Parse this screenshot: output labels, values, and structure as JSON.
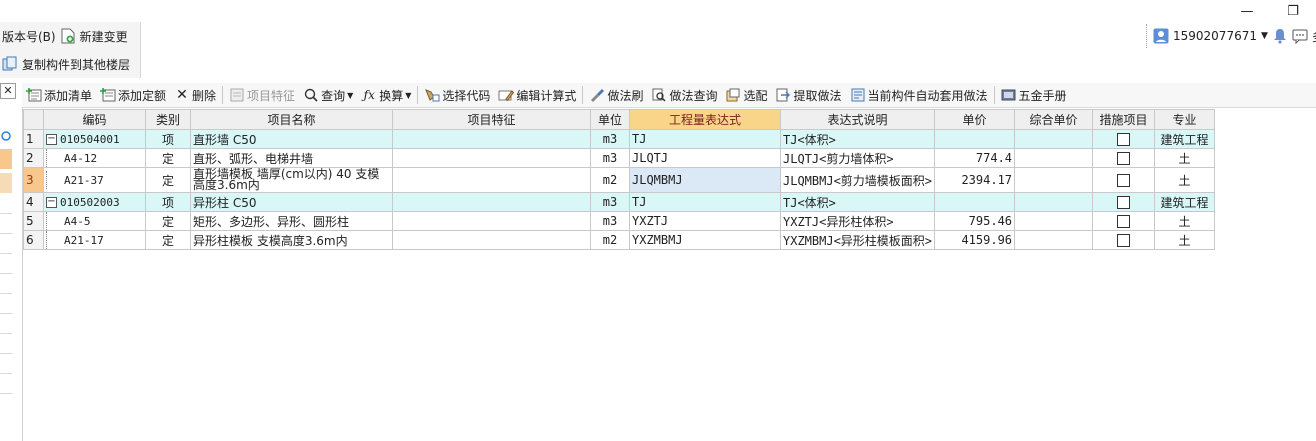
{
  "window": {
    "minimize_glyph": "—",
    "restore_glyph": "❐"
  },
  "topbar": {
    "version_label": "版本号(B)",
    "new_change_label": "新建变更",
    "copy_label": "复制构件到其他楼层"
  },
  "user": {
    "phone": "15902077671",
    "more_label": "多"
  },
  "toolbar": {
    "add_list": "添加清单",
    "add_quota": "添加定额",
    "delete": "删除",
    "item_feature": "项目特征",
    "query": "查询",
    "convert": "换算",
    "select_code": "选择代码",
    "edit_formula": "编辑计算式",
    "method_brush": "做法刷",
    "method_query": "做法查询",
    "select_match": "选配",
    "extract_method": "提取做法",
    "auto_apply": "当前构件自动套用做法",
    "hardware_manual": "五金手册"
  },
  "table": {
    "headers": [
      "编码",
      "类别",
      "项目名称",
      "项目特征",
      "单位",
      "工程量表达式",
      "表达式说明",
      "单价",
      "综合单价",
      "措施项目",
      "专业"
    ],
    "rows": [
      {
        "no": "1",
        "code": "010504001",
        "type": "项",
        "name": "直形墙  C50",
        "feature": "",
        "unit": "m3",
        "expr": "TJ",
        "desc": "TJ<体积>",
        "price": "",
        "total": "",
        "measure": false,
        "major": "建筑工程",
        "level": "item"
      },
      {
        "no": "2",
        "code": "A4-12",
        "type": "定",
        "name": "直形、弧形、电梯井墙",
        "feature": "",
        "unit": "m3",
        "expr": "JLQTJ",
        "desc": "JLQTJ<剪力墙体积>",
        "price": "774.4",
        "total": "",
        "measure": false,
        "major": "土",
        "level": "quota"
      },
      {
        "no": "3",
        "code": "A21-37",
        "type": "定",
        "name": "直形墙模板 墙厚(cm以内) 40 支模高度3.6m内",
        "feature": "",
        "unit": "m2",
        "expr": "JLQMBMJ",
        "desc": "JLQMBMJ<剪力墙模板面积>",
        "price": "2394.17",
        "total": "",
        "measure": false,
        "major": "土",
        "level": "quota"
      },
      {
        "no": "4",
        "code": "010502003",
        "type": "项",
        "name": "异形柱  C50",
        "feature": "",
        "unit": "m3",
        "expr": "TJ",
        "desc": "TJ<体积>",
        "price": "",
        "total": "",
        "measure": false,
        "major": "建筑工程",
        "level": "item"
      },
      {
        "no": "5",
        "code": "A4-5",
        "type": "定",
        "name": "矩形、多边形、异形、圆形柱",
        "feature": "",
        "unit": "m3",
        "expr": "YXZTJ",
        "desc": "YXZTJ<异形柱体积>",
        "price": "795.46",
        "total": "",
        "measure": false,
        "major": "土",
        "level": "quota"
      },
      {
        "no": "6",
        "code": "A21-17",
        "type": "定",
        "name": "异形柱模板 支模高度3.6m内",
        "feature": "",
        "unit": "m2",
        "expr": "YXZMBMJ",
        "desc": "YXZMBMJ<异形柱模板面积>",
        "price": "4159.96",
        "total": "",
        "measure": false,
        "major": "土",
        "level": "quota"
      }
    ]
  },
  "colors": {
    "item_row": "#d9f7f7",
    "active_header": "#f9d58a",
    "selected_row_number": "#f8c78e"
  }
}
